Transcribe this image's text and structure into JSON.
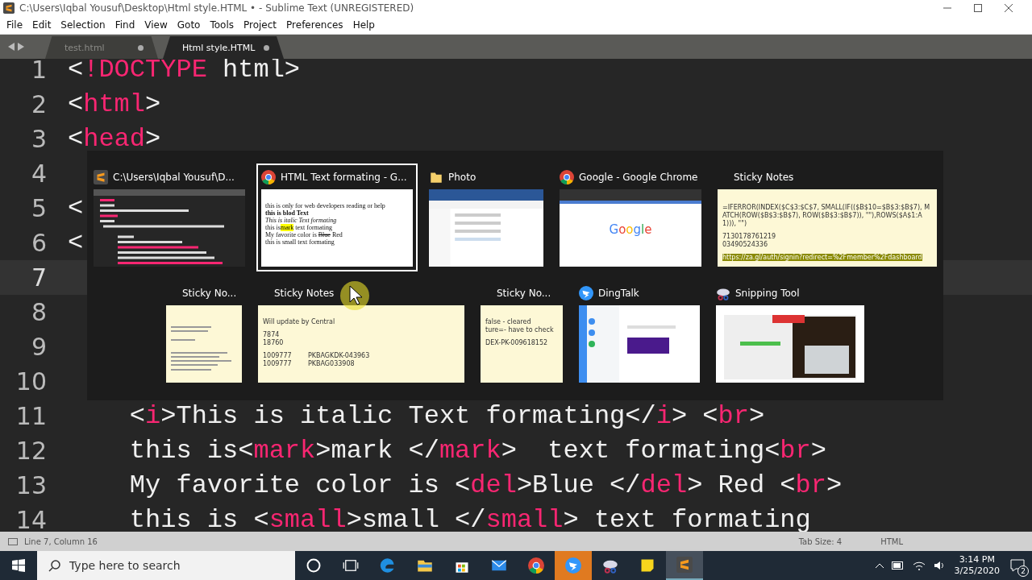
{
  "window": {
    "title": "C:\\Users\\Iqbal Yousuf\\Desktop\\Html style.HTML • - Sublime Text (UNREGISTERED)"
  },
  "menu": [
    "File",
    "Edit",
    "Selection",
    "Find",
    "View",
    "Goto",
    "Tools",
    "Project",
    "Preferences",
    "Help"
  ],
  "tabs": [
    {
      "label": "test.html",
      "selected": false,
      "dirty": true
    },
    {
      "label": "Html style.HTML",
      "selected": true,
      "dirty": true
    }
  ],
  "editor": {
    "lines": [
      {
        "number": "1",
        "text": "<!DOCTYPE html>",
        "current": false
      },
      {
        "number": "2",
        "text": "<html>",
        "current": false
      },
      {
        "number": "3",
        "text": "<head>",
        "current": false
      },
      {
        "number": "4",
        "current": false
      },
      {
        "number": "5",
        "text": "<",
        "current": false
      },
      {
        "number": "6",
        "text": "<",
        "current": false
      },
      {
        "number": "7",
        "current": true
      },
      {
        "number": "8",
        "current": false
      },
      {
        "number": "9",
        "current": false
      },
      {
        "number": "10",
        "current": false
      },
      {
        "number": "11",
        "text": "    <i>This is italic Text formating</i> <br>",
        "current": false
      },
      {
        "number": "12",
        "text": "    this is<mark>mark </mark>  text formating<br>",
        "current": false
      },
      {
        "number": "13",
        "text": "    My favorite color is <del>Blue </del> Red <br>",
        "current": false
      },
      {
        "number": "14",
        "text": "    this is <small>small </small> text formating",
        "current": false
      }
    ]
  },
  "switcher": {
    "rows": [
      [
        {
          "title": "C:\\Users\\Iqbal Yousuf\\D...",
          "kind": "sublime",
          "selected": false
        },
        {
          "title": "HTML Text formating - G...",
          "kind": "chrome-page",
          "selected": true,
          "page": [
            {
              "kind": "plain",
              "text": "this is only for web developers reading or help"
            },
            {
              "kind": "bold",
              "text": "this is blod Text"
            },
            {
              "kind": "italic",
              "text": "This is italic Text formating"
            },
            {
              "kind": "mark",
              "before": "this is",
              "marked": "mark",
              "after": "text formating"
            },
            {
              "kind": "del",
              "before": "My favorite color is ",
              "struck": "Blue",
              "after": "Red"
            },
            {
              "kind": "small",
              "text": "this is small text formating"
            }
          ]
        },
        {
          "title": "Photo",
          "kind": "explorer",
          "selected": false
        },
        {
          "title": "Google - Google Chrome",
          "kind": "chrome-google",
          "selected": false,
          "logo": "Google"
        },
        {
          "title": "Sticky Notes",
          "kind": "sticky",
          "selected": false,
          "note": [
            [
              "=IFERROR(INDEX($C$3:$C$7, SMALL(IF(($B$10=$B$3:$B$7), MATCH(ROW($B$3:$B$7), ROW($B$3:$B$7)), \"\"),ROWS($A$1:A1))), \"\")"
            ],
            [
              "7130178761219",
              "03490524336"
            ]
          ],
          "highlight": "https://za.gl/auth/signin?redirect=%2Fmember%2Fdashboard"
        }
      ],
      [
        {
          "title": "Sticky No...",
          "kind": "sticky-scribble",
          "selected": false
        },
        {
          "title": "Sticky Notes",
          "kind": "sticky",
          "selected": false,
          "note": [
            [
              "Will update by Central"
            ],
            [
              "7874",
              "18760"
            ],
            [
              "1009777        PKBAGKDK-043963",
              "1009777        PKBAG033908"
            ]
          ]
        },
        {
          "title": "Sticky No...",
          "kind": "sticky",
          "selected": false,
          "note": [
            [
              "false - cleared",
              "ture=- have to check"
            ],
            [
              "DEX-PK-009618152"
            ]
          ]
        },
        {
          "title": "DingTalk",
          "kind": "dingtalk",
          "selected": false
        },
        {
          "title": "Snipping Tool",
          "kind": "snipping",
          "selected": false
        }
      ]
    ]
  },
  "status_bar": {
    "position": "Line 7, Column 16",
    "tab_size": "Tab Size: 4",
    "syntax": "HTML"
  },
  "taskbar": {
    "search": {
      "placeholder": "Type here to search"
    },
    "apps": [
      {
        "kind": "cortana",
        "alert": false,
        "active": false
      },
      {
        "kind": "taskview",
        "alert": false,
        "active": false
      },
      {
        "kind": "edge",
        "alert": false,
        "active": false
      },
      {
        "kind": "explorer",
        "alert": false,
        "active": false
      },
      {
        "kind": "store",
        "alert": false,
        "active": false
      },
      {
        "kind": "mail",
        "alert": false,
        "active": false
      },
      {
        "kind": "chrome",
        "alert": false,
        "active": false
      },
      {
        "kind": "dingtalk",
        "alert": true,
        "active": false
      },
      {
        "kind": "snip",
        "alert": false,
        "active": false
      },
      {
        "kind": "sticky",
        "alert": false,
        "active": false
      },
      {
        "kind": "sublime",
        "alert": false,
        "active": true
      }
    ],
    "time": "3:14 PM",
    "date": "3/25/2020",
    "notifications": "2"
  }
}
